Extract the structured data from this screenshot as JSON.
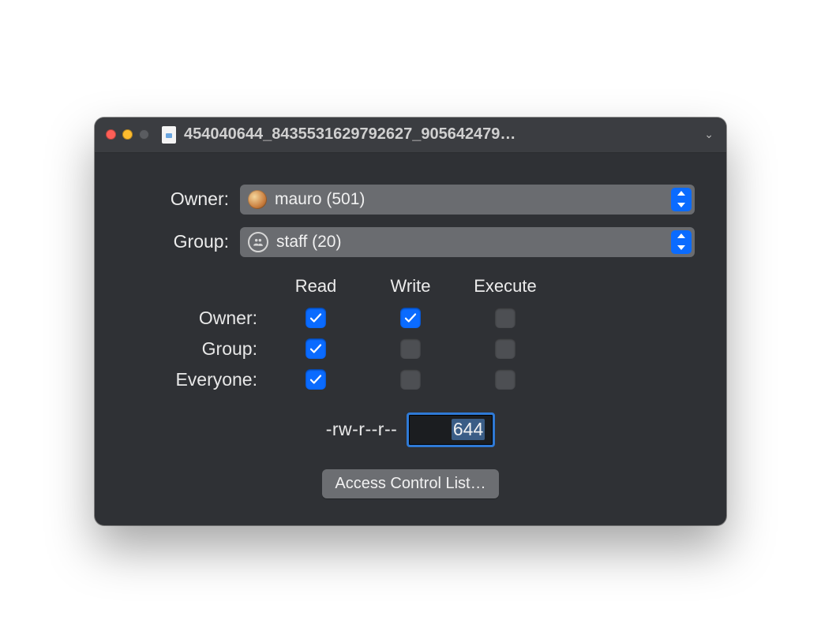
{
  "window": {
    "title": "454040644_8435531629792627_905642479…"
  },
  "owner": {
    "label": "Owner:",
    "value": "mauro (501)"
  },
  "group": {
    "label": "Group:",
    "value": "staff (20)"
  },
  "perm_cols": {
    "read": "Read",
    "write": "Write",
    "execute": "Execute"
  },
  "perm_rows": {
    "owner": {
      "label": "Owner:",
      "read": true,
      "write": true,
      "execute": false
    },
    "group": {
      "label": "Group:",
      "read": true,
      "write": false,
      "execute": false
    },
    "everyone": {
      "label": "Everyone:",
      "read": true,
      "write": false,
      "execute": false
    }
  },
  "perm_string": "-rw-r--r--",
  "perm_octal": "644",
  "acl_button": "Access Control List…"
}
